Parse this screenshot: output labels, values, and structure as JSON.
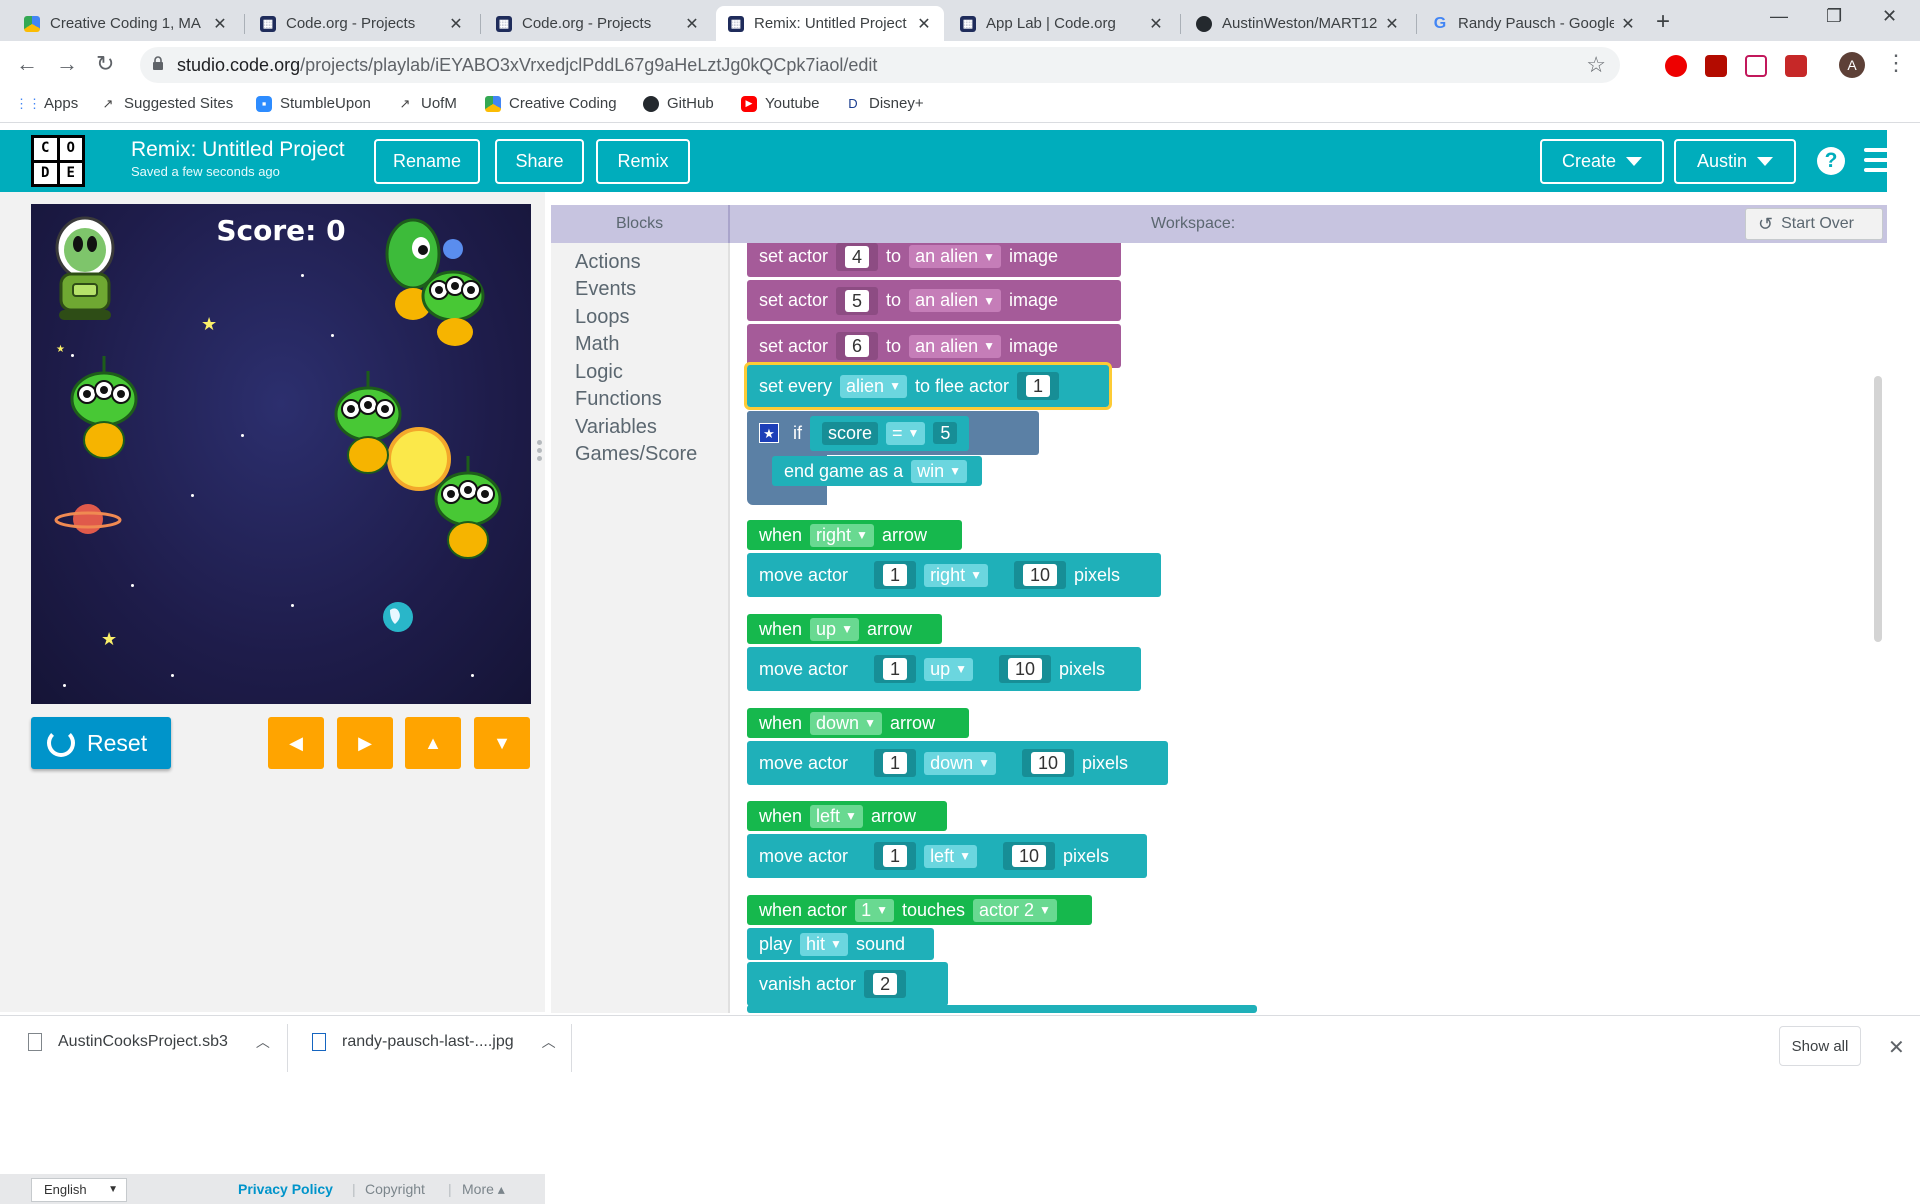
{
  "browser": {
    "tabs": [
      {
        "title": "Creative Coding 1, MA",
        "icon": "drive-icon",
        "active": false
      },
      {
        "title": "Code.org - Projects",
        "icon": "codeorg-icon",
        "active": false
      },
      {
        "title": "Code.org - Projects",
        "icon": "codeorg-icon",
        "active": false
      },
      {
        "title": "Remix: Untitled Project",
        "icon": "codeorg-icon",
        "active": true
      },
      {
        "title": "App Lab | Code.org",
        "icon": "codeorg-icon",
        "active": false
      },
      {
        "title": "AustinWeston/MART12",
        "icon": "github-icon",
        "active": false
      },
      {
        "title": "Randy Pausch - Google",
        "icon": "google-icon",
        "active": false
      }
    ],
    "url_host": "studio.code.org",
    "url_path": "/projects/playlab/iEYABO3xVrxedjclPddL67g9aHeLztJg0kQCpk7iaol/edit",
    "avatar_letter": "A",
    "bookmarks": [
      {
        "label": "Apps",
        "icon": "apps-grid-icon"
      },
      {
        "label": "Suggested Sites",
        "icon": "suggested-sites-icon"
      },
      {
        "label": "StumbleUpon",
        "icon": "stumbleupon-icon"
      },
      {
        "label": "UofM",
        "icon": "uofm-icon"
      },
      {
        "label": "Creative Coding",
        "icon": "drive-icon"
      },
      {
        "label": "GitHub",
        "icon": "github-icon"
      },
      {
        "label": "Youtube",
        "icon": "youtube-icon"
      },
      {
        "label": "Disney+",
        "icon": "disney-icon"
      }
    ]
  },
  "header": {
    "logo_letters": [
      "C",
      "O",
      "D",
      "E"
    ],
    "project_title": "Remix: Untitled Project",
    "saved_status": "Saved a few seconds ago",
    "rename_label": "Rename",
    "share_label": "Share",
    "remix_label": "Remix",
    "create_label": "Create",
    "user_label": "Austin",
    "help_label": "?"
  },
  "game": {
    "score_text": "Score: 0",
    "reset_label": "Reset",
    "arrow_labels": [
      "◀",
      "▶",
      "▲",
      "▼"
    ]
  },
  "footer": {
    "language": "English",
    "privacy_label": "Privacy Policy",
    "copyright_label": "Copyright",
    "more_label": "More ▴"
  },
  "editor": {
    "blocks_header": "Blocks",
    "workspace_header": "Workspace:",
    "start_over_label": "Start Over",
    "categories": [
      "Actions",
      "Events",
      "Loops",
      "Math",
      "Logic",
      "Functions",
      "Variables",
      "Games/Score"
    ]
  },
  "code": {
    "set_actor": [
      {
        "kw1": "set actor",
        "num": "4",
        "kw2": "to",
        "choice": "an alien",
        "kw3": "image"
      },
      {
        "kw1": "set actor",
        "num": "5",
        "kw2": "to",
        "choice": "an alien",
        "kw3": "image"
      },
      {
        "kw1": "set actor",
        "num": "6",
        "kw2": "to",
        "choice": "an alien",
        "kw3": "image"
      }
    ],
    "flee": {
      "kw1": "set every",
      "choice": "alien",
      "kw2": "to flee actor",
      "num": "1"
    },
    "if_block": {
      "kw": "if",
      "var": "score",
      "op": "=",
      "value": "5"
    },
    "end_game": {
      "kw": "end game as a",
      "choice": "win"
    },
    "arrow_handlers": [
      {
        "when": "when",
        "key": "right",
        "arrow": "arrow",
        "move": "move actor",
        "actor": "1",
        "dir": "right",
        "dist": "10",
        "unit": "pixels"
      },
      {
        "when": "when",
        "key": "up",
        "arrow": "arrow",
        "move": "move actor",
        "actor": "1",
        "dir": "up",
        "dist": "10",
        "unit": "pixels"
      },
      {
        "when": "when",
        "key": "down",
        "arrow": "arrow",
        "move": "move actor",
        "actor": "1",
        "dir": "down",
        "dist": "10",
        "unit": "pixels"
      },
      {
        "when": "when",
        "key": "left",
        "arrow": "arrow",
        "move": "move actor",
        "actor": "1",
        "dir": "left",
        "dist": "10",
        "unit": "pixels"
      }
    ],
    "touch_handler": {
      "kw1": "when actor",
      "actor_a": "1",
      "kw2": "touches",
      "actor_b": "actor 2",
      "play_kw": "play",
      "sound": "hit",
      "sound_kw": "sound",
      "vanish_kw": "vanish actor",
      "vanish_num": "2"
    }
  },
  "downloads": {
    "items": [
      "AustinCooksProject.sb3",
      "randy-pausch-last-....jpg"
    ],
    "show_all_label": "Show all"
  },
  "colors": {
    "header_teal": "#00adbc",
    "block_purple": "#a55b99",
    "block_teal": "#1fb0b9",
    "block_green": "#16b84d",
    "reset_blue": "#0094ca",
    "arrow_orange": "#ffa400"
  }
}
